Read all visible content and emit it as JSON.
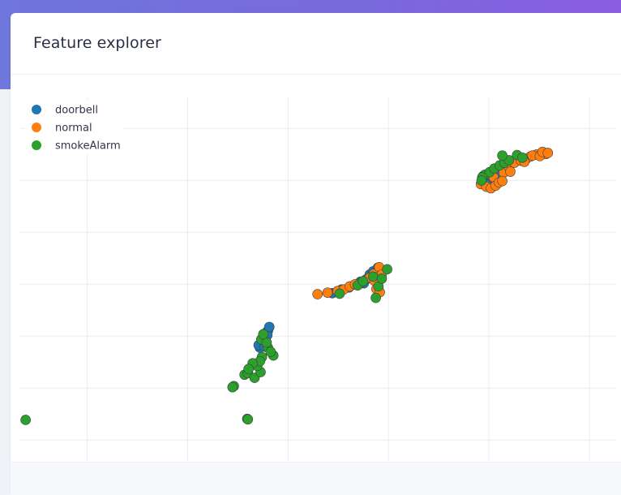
{
  "page": {
    "title": "Feature explorer"
  },
  "chart_data": {
    "type": "scatter",
    "title": "",
    "xlabel": "",
    "ylabel": "",
    "grid": true,
    "legend_position": "top-left",
    "xlim": [
      -10,
      79
    ],
    "ylim": [
      -9,
      61
    ],
    "series": [
      {
        "name": "doorbell",
        "color": "#1f77b4",
        "points": [
          [
            26.8,
            15.8
          ],
          [
            26.6,
            14.6
          ],
          [
            27.0,
            16.1
          ],
          [
            26.2,
            13.6
          ],
          [
            25.8,
            12.8
          ],
          [
            26.4,
            14.0
          ],
          [
            25.6,
            13.3
          ],
          [
            26.9,
            15.2
          ],
          [
            27.2,
            16.8
          ],
          [
            26.5,
            13.0
          ],
          [
            42.2,
            26.9
          ],
          [
            41.7,
            26.0
          ],
          [
            42.7,
            27.5
          ],
          [
            43.4,
            28.2
          ],
          [
            42.9,
            27.0
          ],
          [
            41.3,
            25.2
          ],
          [
            40.2,
            24.9
          ],
          [
            39.1,
            24.4
          ],
          [
            38.0,
            24.0
          ],
          [
            36.6,
            23.3
          ],
          [
            40.8,
            25.5
          ],
          [
            43.8,
            27.8
          ],
          [
            60.0,
            45.0
          ],
          [
            60.6,
            46.0
          ],
          [
            61.2,
            46.4
          ],
          [
            59.7,
            44.2
          ]
        ]
      },
      {
        "name": "normal",
        "color": "#ff7f0e",
        "points": [
          [
            34.4,
            23.1
          ],
          [
            35.9,
            23.4
          ],
          [
            37.4,
            23.7
          ],
          [
            38.3,
            24.0
          ],
          [
            39.2,
            24.6
          ],
          [
            40.0,
            25.0
          ],
          [
            41.0,
            25.4
          ],
          [
            42.2,
            26.3
          ],
          [
            42.8,
            27.0
          ],
          [
            43.6,
            28.3
          ],
          [
            44.0,
            26.9
          ],
          [
            42.9,
            25.7
          ],
          [
            43.2,
            24.1
          ],
          [
            43.7,
            23.5
          ],
          [
            59.1,
            45.8
          ],
          [
            60.7,
            45.6
          ],
          [
            62.2,
            46.5
          ],
          [
            63.0,
            47.6
          ],
          [
            63.8,
            48.4
          ],
          [
            64.8,
            48.8
          ],
          [
            65.6,
            49.2
          ],
          [
            66.2,
            49.6
          ],
          [
            67.1,
            50.0
          ],
          [
            67.9,
            50.2
          ],
          [
            68.5,
            50.1
          ],
          [
            58.8,
            44.3
          ],
          [
            59.6,
            43.8
          ],
          [
            60.3,
            43.5
          ],
          [
            61.0,
            44.0
          ],
          [
            61.5,
            44.6
          ],
          [
            62.0,
            44.9
          ],
          [
            63.2,
            46.7
          ],
          [
            65.3,
            48.6
          ],
          [
            66.5,
            49.8
          ],
          [
            67.6,
            49.7
          ],
          [
            68.0,
            50.5
          ],
          [
            68.8,
            50.3
          ]
        ]
      },
      {
        "name": "smokeAlarm",
        "color": "#2ca02c",
        "points": [
          [
            -9.2,
            -1.1
          ],
          [
            21.9,
            5.4
          ],
          [
            21.7,
            5.2
          ],
          [
            23.9,
            -0.9
          ],
          [
            24.0,
            -1.0
          ],
          [
            23.5,
            7.6
          ],
          [
            24.0,
            7.9
          ],
          [
            25.0,
            7.0
          ],
          [
            25.9,
            8.1
          ],
          [
            25.4,
            9.3
          ],
          [
            26.1,
            11.0
          ],
          [
            27.0,
            12.8
          ],
          [
            27.8,
            11.3
          ],
          [
            26.0,
            14.4
          ],
          [
            26.8,
            13.8
          ],
          [
            27.4,
            12.0
          ],
          [
            26.3,
            15.4
          ],
          [
            25.8,
            10.2
          ],
          [
            24.7,
            9.8
          ],
          [
            24.1,
            8.7
          ],
          [
            37.7,
            23.2
          ],
          [
            40.4,
            24.8
          ],
          [
            41.2,
            25.6
          ],
          [
            42.7,
            26.5
          ],
          [
            43.5,
            24.6
          ],
          [
            43.1,
            22.4
          ],
          [
            44.8,
            27.9
          ],
          [
            44.0,
            26.1
          ],
          [
            59.4,
            46.1
          ],
          [
            60.1,
            46.6
          ],
          [
            60.8,
            47.3
          ],
          [
            61.6,
            47.9
          ],
          [
            62.3,
            48.4
          ],
          [
            63.0,
            48.9
          ],
          [
            62.0,
            49.8
          ],
          [
            64.2,
            49.9
          ],
          [
            65.0,
            49.4
          ],
          [
            59.0,
            45.6
          ],
          [
            58.9,
            45.0
          ]
        ]
      }
    ]
  }
}
